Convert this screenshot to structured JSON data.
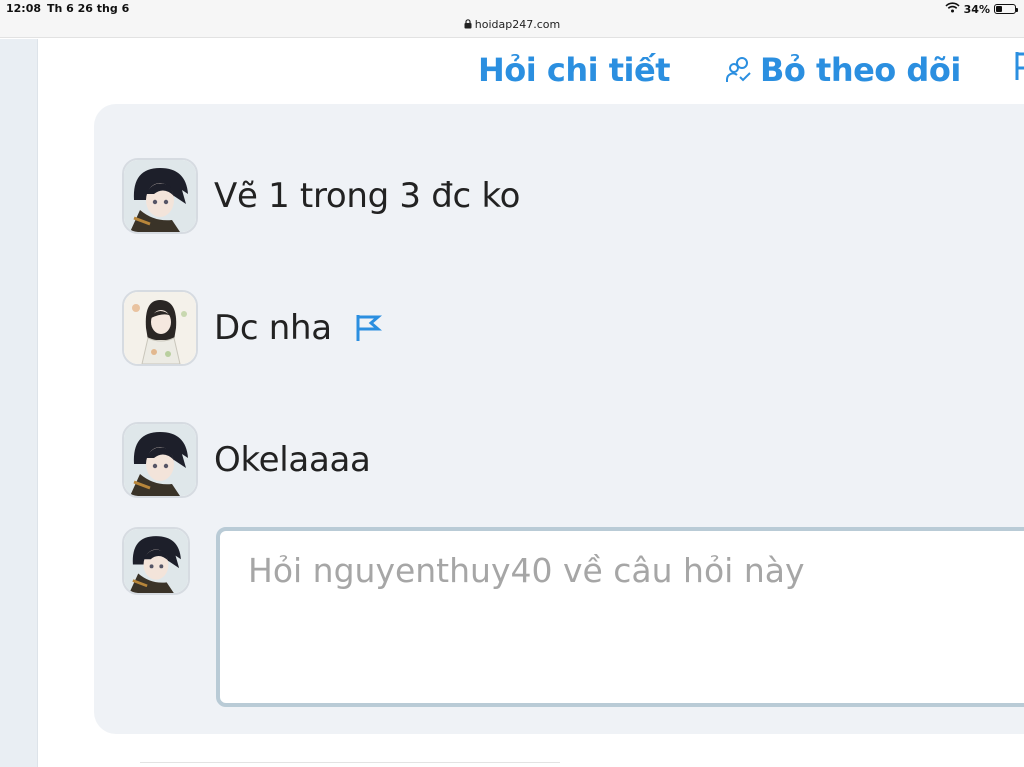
{
  "status_bar": {
    "time": "12:08",
    "date": "Th 6 26 thg 6",
    "url": "hoidap247.com",
    "battery": "34%",
    "battery_level": 0.34
  },
  "actions": {
    "ask_detail": "Hỏi chi tiết",
    "unfollow": "Bỏ theo dõi"
  },
  "comments": [
    {
      "text": "Vẽ 1 trong 3 đc ko",
      "avatar": "anime-girl-dark-hair-avatar"
    },
    {
      "text": "Dc nha",
      "avatar": "anime-girl-white-dress-avatar",
      "reportable": true
    },
    {
      "text": "Okelaaaa",
      "avatar": "anime-girl-dark-hair-avatar"
    }
  ],
  "reply": {
    "placeholder": "Hỏi nguyenthuy40 về câu hỏi này",
    "value": ""
  },
  "colors": {
    "accent": "#2b8fe0",
    "panel_bg": "#eff2f6",
    "input_border": "#b9cbd6",
    "placeholder": "#a6a6a6"
  }
}
